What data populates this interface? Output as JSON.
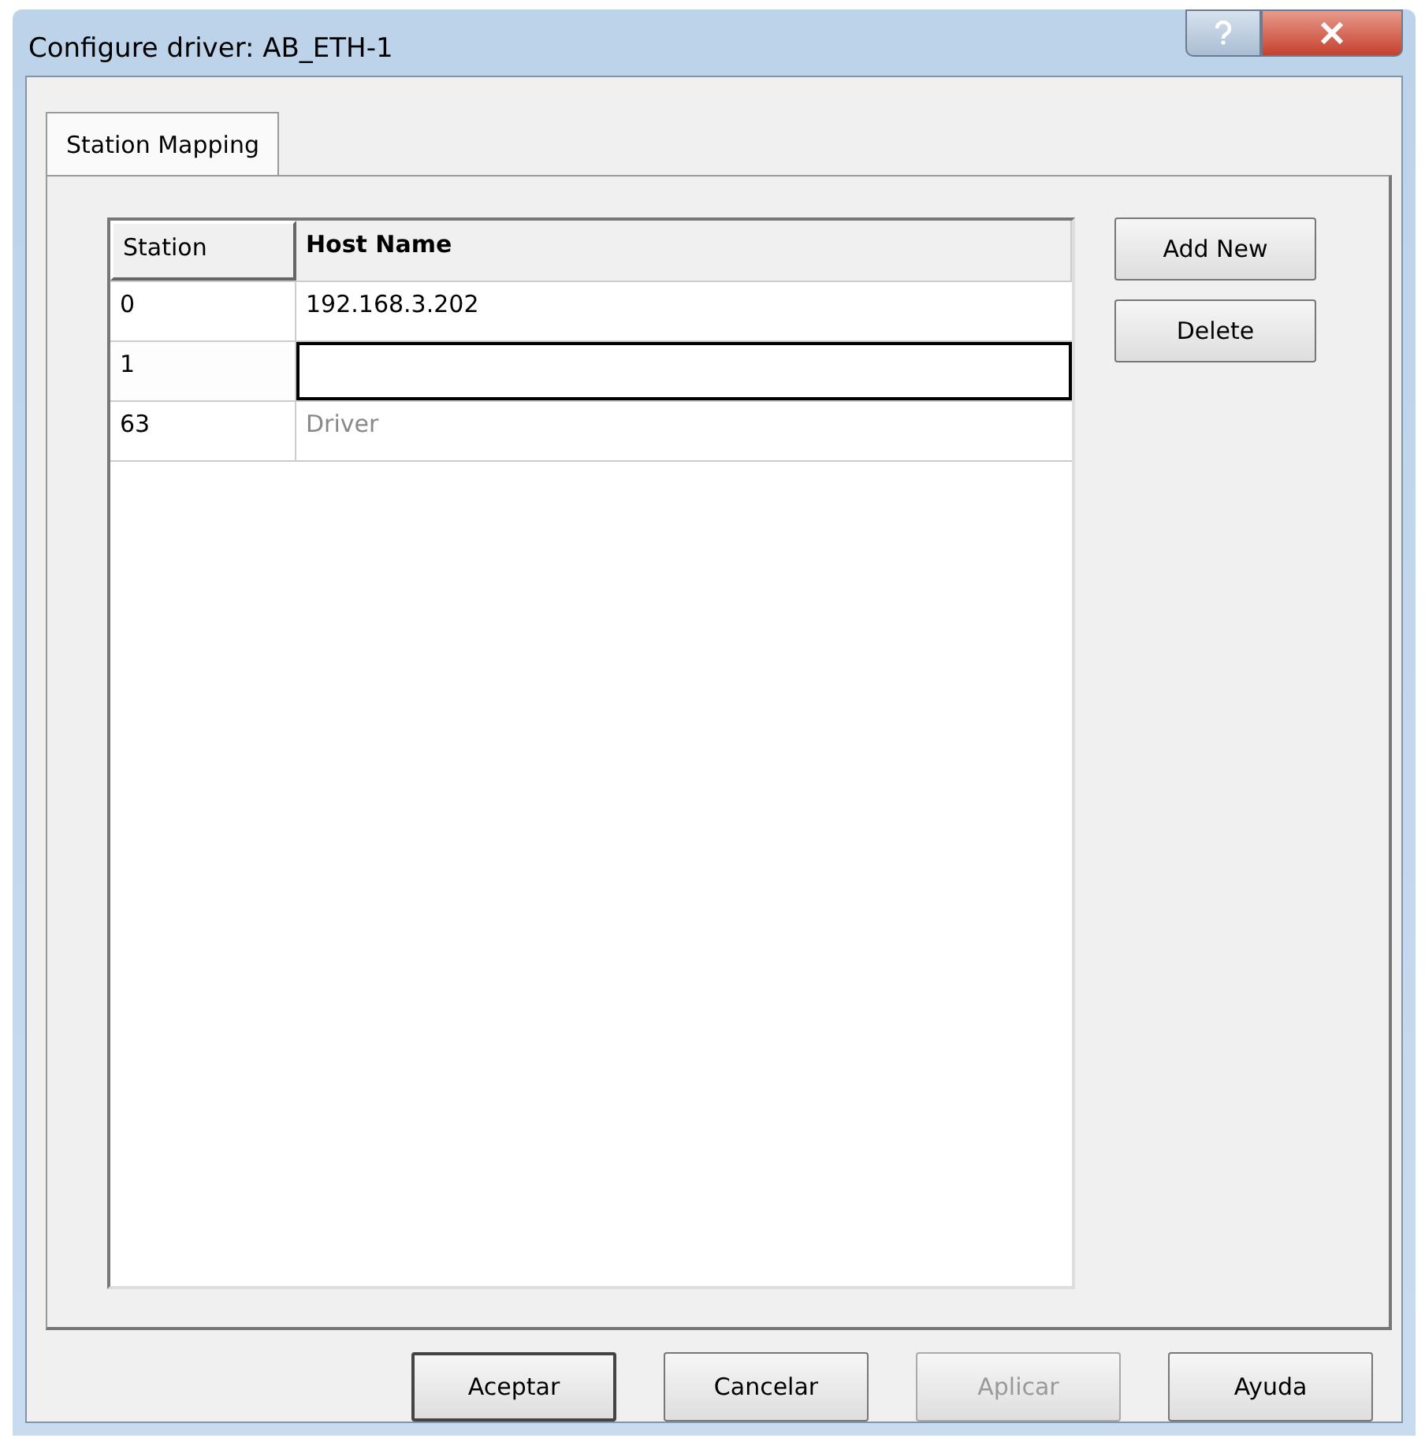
{
  "window": {
    "title": "Configure driver: AB_ETH-1"
  },
  "tabs": [
    {
      "label": "Station Mapping",
      "selected": true
    }
  ],
  "table": {
    "columns": [
      "Station",
      "Host Name"
    ],
    "rows": [
      {
        "station": "0",
        "host": "192.168.3.202",
        "editing": false,
        "disabled": false
      },
      {
        "station": "1",
        "editing": true,
        "disabled": false
      },
      {
        "station": "63",
        "host": "Driver",
        "editing": false,
        "disabled": true
      }
    ]
  },
  "side_buttons": [
    {
      "label": "Add New"
    },
    {
      "label": "Delete"
    }
  ],
  "buttons": [
    {
      "label": "Aceptar",
      "default": true,
      "disabled": false
    },
    {
      "label": "Cancelar",
      "default": false,
      "disabled": false
    },
    {
      "label": "Aplicar",
      "default": false,
      "disabled": true
    },
    {
      "label": "Ayuda",
      "default": false,
      "disabled": false
    }
  ]
}
